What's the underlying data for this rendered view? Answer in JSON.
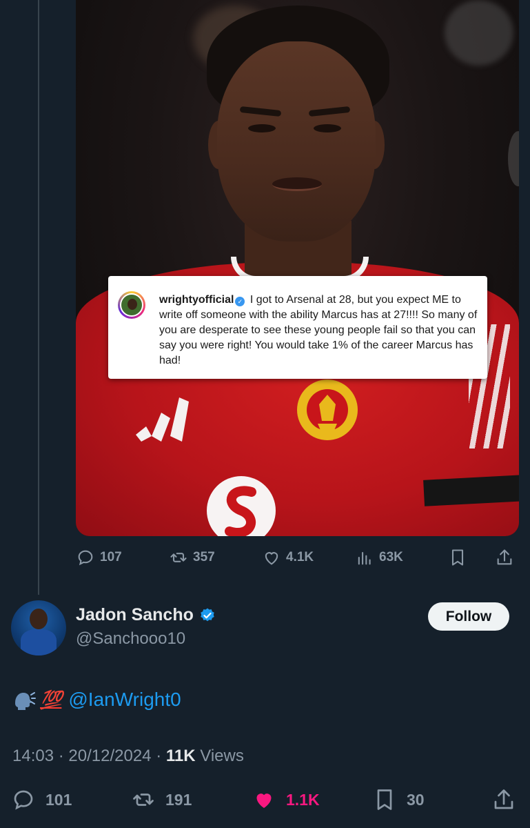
{
  "media": {
    "ig_post": {
      "username": "wrightyofficial",
      "caption": "I got to Arsenal at 28, but you expect ME to write off someone with the ability Marcus has at 27!!!! So many of you are desperate to see these young people fail so that you can say you were right! You would take 1% of the career Marcus has had!"
    }
  },
  "quoted_actions": {
    "replies": "107",
    "reposts": "357",
    "likes": "4.1K",
    "views": "63K"
  },
  "tweet": {
    "author_name": "Jadon Sancho",
    "author_handle": "@Sanchooo10",
    "follow_label": "Follow",
    "emoji_text": "💯",
    "mention": "@IanWright0",
    "time": "14:03",
    "date": "20/12/2024",
    "views_count": "11K",
    "views_label": "Views",
    "separator": "·"
  },
  "actions": {
    "replies": "101",
    "reposts": "191",
    "likes": "1.1K",
    "bookmarks": "30"
  },
  "colors": {
    "background": "#15202b",
    "accent": "#1d9bf0",
    "like": "#f91880",
    "muted": "#8b98a5"
  }
}
